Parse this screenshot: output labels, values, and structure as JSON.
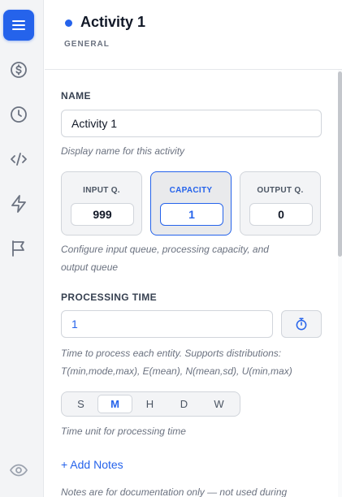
{
  "sidebar": {
    "items": [
      {
        "name": "menu",
        "icon": "menu-icon",
        "active": true
      },
      {
        "name": "cost",
        "icon": "dollar-circle-icon",
        "active": false
      },
      {
        "name": "time",
        "icon": "clock-icon",
        "active": false
      },
      {
        "name": "code",
        "icon": "code-icon",
        "active": false
      },
      {
        "name": "events",
        "icon": "lightning-icon",
        "active": false
      },
      {
        "name": "goals",
        "icon": "flag-icon",
        "active": false
      },
      {
        "name": "visibility",
        "icon": "eye-icon",
        "active": false
      }
    ]
  },
  "header": {
    "title": "Activity 1",
    "subtitle": "GENERAL",
    "status_color": "#2563eb"
  },
  "name_section": {
    "label": "NAME",
    "value": "Activity 1",
    "hint": "Display name for this activity"
  },
  "queues": {
    "cards": [
      {
        "label": "INPUT Q.",
        "value": "999",
        "active": false
      },
      {
        "label": "CAPACITY",
        "value": "1",
        "active": true
      },
      {
        "label": "OUTPUT Q.",
        "value": "0",
        "active": false
      }
    ],
    "hint_line1": "Configure input queue, processing capacity, and",
    "hint_line2": "output queue"
  },
  "processing": {
    "label": "PROCESSING TIME",
    "value": "1",
    "timer_icon": "stopwatch-icon",
    "hint_line1": "Time to process each entity. Supports distributions:",
    "hint_line2": "T(min,mode,max), E(mean), N(mean,sd), U(min,max)"
  },
  "time_unit": {
    "options": [
      "S",
      "M",
      "H",
      "D",
      "W"
    ],
    "selected": "M",
    "hint": "Time unit for processing time"
  },
  "notes": {
    "add_label": "+ Add Notes",
    "hint": "Notes are for documentation only — not used during"
  },
  "colors": {
    "accent": "#2563eb",
    "sidebar_bg": "#f3f4f6",
    "icon": "#6b7280"
  }
}
